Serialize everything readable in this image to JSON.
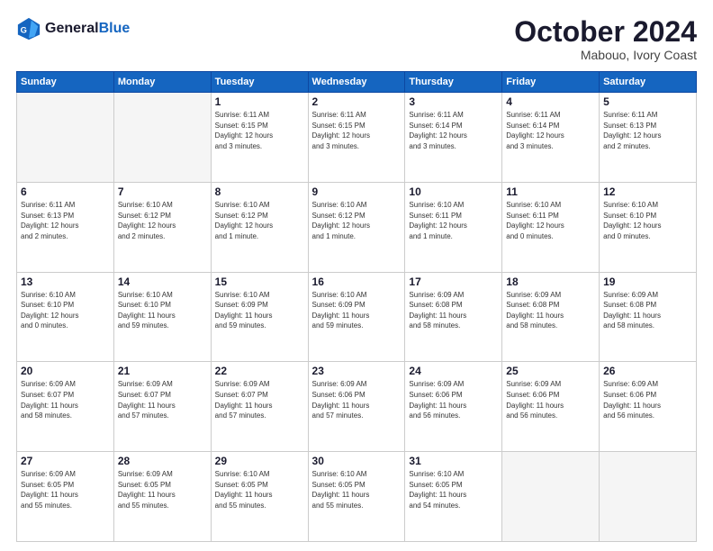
{
  "header": {
    "logo_line1": "General",
    "logo_line2": "Blue",
    "month_title": "October 2024",
    "location": "Mabouo, Ivory Coast"
  },
  "weekdays": [
    "Sunday",
    "Monday",
    "Tuesday",
    "Wednesday",
    "Thursday",
    "Friday",
    "Saturday"
  ],
  "weeks": [
    [
      {
        "day": "",
        "info": ""
      },
      {
        "day": "",
        "info": ""
      },
      {
        "day": "1",
        "info": "Sunrise: 6:11 AM\nSunset: 6:15 PM\nDaylight: 12 hours\nand 3 minutes."
      },
      {
        "day": "2",
        "info": "Sunrise: 6:11 AM\nSunset: 6:15 PM\nDaylight: 12 hours\nand 3 minutes."
      },
      {
        "day": "3",
        "info": "Sunrise: 6:11 AM\nSunset: 6:14 PM\nDaylight: 12 hours\nand 3 minutes."
      },
      {
        "day": "4",
        "info": "Sunrise: 6:11 AM\nSunset: 6:14 PM\nDaylight: 12 hours\nand 3 minutes."
      },
      {
        "day": "5",
        "info": "Sunrise: 6:11 AM\nSunset: 6:13 PM\nDaylight: 12 hours\nand 2 minutes."
      }
    ],
    [
      {
        "day": "6",
        "info": "Sunrise: 6:11 AM\nSunset: 6:13 PM\nDaylight: 12 hours\nand 2 minutes."
      },
      {
        "day": "7",
        "info": "Sunrise: 6:10 AM\nSunset: 6:12 PM\nDaylight: 12 hours\nand 2 minutes."
      },
      {
        "day": "8",
        "info": "Sunrise: 6:10 AM\nSunset: 6:12 PM\nDaylight: 12 hours\nand 1 minute."
      },
      {
        "day": "9",
        "info": "Sunrise: 6:10 AM\nSunset: 6:12 PM\nDaylight: 12 hours\nand 1 minute."
      },
      {
        "day": "10",
        "info": "Sunrise: 6:10 AM\nSunset: 6:11 PM\nDaylight: 12 hours\nand 1 minute."
      },
      {
        "day": "11",
        "info": "Sunrise: 6:10 AM\nSunset: 6:11 PM\nDaylight: 12 hours\nand 0 minutes."
      },
      {
        "day": "12",
        "info": "Sunrise: 6:10 AM\nSunset: 6:10 PM\nDaylight: 12 hours\nand 0 minutes."
      }
    ],
    [
      {
        "day": "13",
        "info": "Sunrise: 6:10 AM\nSunset: 6:10 PM\nDaylight: 12 hours\nand 0 minutes."
      },
      {
        "day": "14",
        "info": "Sunrise: 6:10 AM\nSunset: 6:10 PM\nDaylight: 11 hours\nand 59 minutes."
      },
      {
        "day": "15",
        "info": "Sunrise: 6:10 AM\nSunset: 6:09 PM\nDaylight: 11 hours\nand 59 minutes."
      },
      {
        "day": "16",
        "info": "Sunrise: 6:10 AM\nSunset: 6:09 PM\nDaylight: 11 hours\nand 59 minutes."
      },
      {
        "day": "17",
        "info": "Sunrise: 6:09 AM\nSunset: 6:08 PM\nDaylight: 11 hours\nand 58 minutes."
      },
      {
        "day": "18",
        "info": "Sunrise: 6:09 AM\nSunset: 6:08 PM\nDaylight: 11 hours\nand 58 minutes."
      },
      {
        "day": "19",
        "info": "Sunrise: 6:09 AM\nSunset: 6:08 PM\nDaylight: 11 hours\nand 58 minutes."
      }
    ],
    [
      {
        "day": "20",
        "info": "Sunrise: 6:09 AM\nSunset: 6:07 PM\nDaylight: 11 hours\nand 58 minutes."
      },
      {
        "day": "21",
        "info": "Sunrise: 6:09 AM\nSunset: 6:07 PM\nDaylight: 11 hours\nand 57 minutes."
      },
      {
        "day": "22",
        "info": "Sunrise: 6:09 AM\nSunset: 6:07 PM\nDaylight: 11 hours\nand 57 minutes."
      },
      {
        "day": "23",
        "info": "Sunrise: 6:09 AM\nSunset: 6:06 PM\nDaylight: 11 hours\nand 57 minutes."
      },
      {
        "day": "24",
        "info": "Sunrise: 6:09 AM\nSunset: 6:06 PM\nDaylight: 11 hours\nand 56 minutes."
      },
      {
        "day": "25",
        "info": "Sunrise: 6:09 AM\nSunset: 6:06 PM\nDaylight: 11 hours\nand 56 minutes."
      },
      {
        "day": "26",
        "info": "Sunrise: 6:09 AM\nSunset: 6:06 PM\nDaylight: 11 hours\nand 56 minutes."
      }
    ],
    [
      {
        "day": "27",
        "info": "Sunrise: 6:09 AM\nSunset: 6:05 PM\nDaylight: 11 hours\nand 55 minutes."
      },
      {
        "day": "28",
        "info": "Sunrise: 6:09 AM\nSunset: 6:05 PM\nDaylight: 11 hours\nand 55 minutes."
      },
      {
        "day": "29",
        "info": "Sunrise: 6:10 AM\nSunset: 6:05 PM\nDaylight: 11 hours\nand 55 minutes."
      },
      {
        "day": "30",
        "info": "Sunrise: 6:10 AM\nSunset: 6:05 PM\nDaylight: 11 hours\nand 55 minutes."
      },
      {
        "day": "31",
        "info": "Sunrise: 6:10 AM\nSunset: 6:05 PM\nDaylight: 11 hours\nand 54 minutes."
      },
      {
        "day": "",
        "info": ""
      },
      {
        "day": "",
        "info": ""
      }
    ]
  ]
}
